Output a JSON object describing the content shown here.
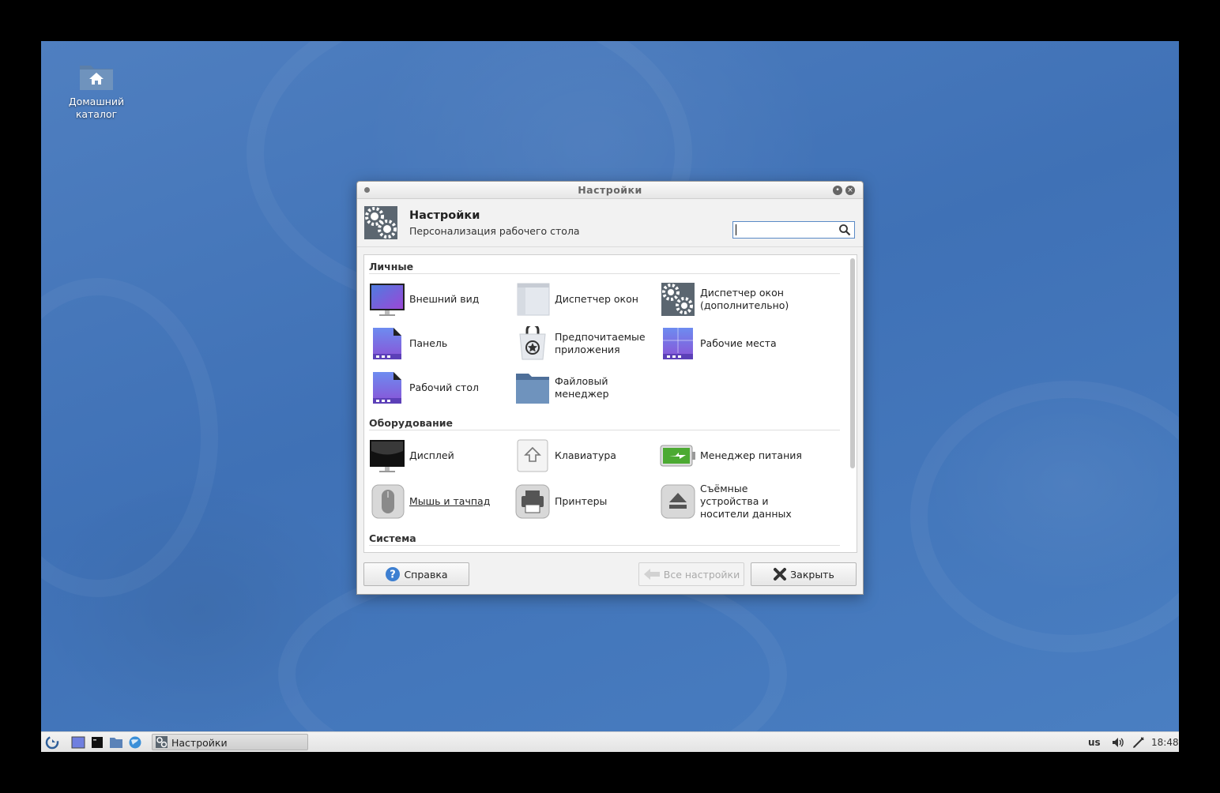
{
  "desktop": {
    "home_label_1": "Домашний",
    "home_label_2": "каталог"
  },
  "window": {
    "title": "Настройки",
    "header_title": "Настройки",
    "header_subtitle": "Персонализация рабочего стола",
    "search_placeholder": ""
  },
  "sections": {
    "personal": "Личные",
    "hardware": "Оборудование",
    "system": "Система"
  },
  "items": {
    "appearance": "Внешний вид",
    "wm": "Диспетчер окон",
    "wm_tweaks_1": "Диспетчер окон",
    "wm_tweaks_2": "(дополнительно)",
    "panel": "Панель",
    "preferred_1": "Предпочитаемые",
    "preferred_2": "приложения",
    "workspaces": "Рабочие места",
    "desktop": "Рабочий стол",
    "filemanager_1": "Файловый",
    "filemanager_2": "менеджер",
    "display": "Дисплей",
    "keyboard": "Клавиатура",
    "power": "Менеджер питания",
    "mouse": "Мышь и тачпад",
    "printers": "Принтеры",
    "removable_1": "Съёмные",
    "removable_2": "устройства и",
    "removable_3": "носители данных"
  },
  "buttons": {
    "help": "Справка",
    "all_settings": "Все настройки",
    "close": "Закрыть"
  },
  "taskbar": {
    "task_label": "Настройки",
    "keyboard_layout": "us",
    "clock": "18:48"
  },
  "colors": {
    "desktop_blue": "#4274b8",
    "accent_purple": "#7a5cd6",
    "power_green": "#4caa32",
    "help_blue": "#3d7fd1"
  }
}
